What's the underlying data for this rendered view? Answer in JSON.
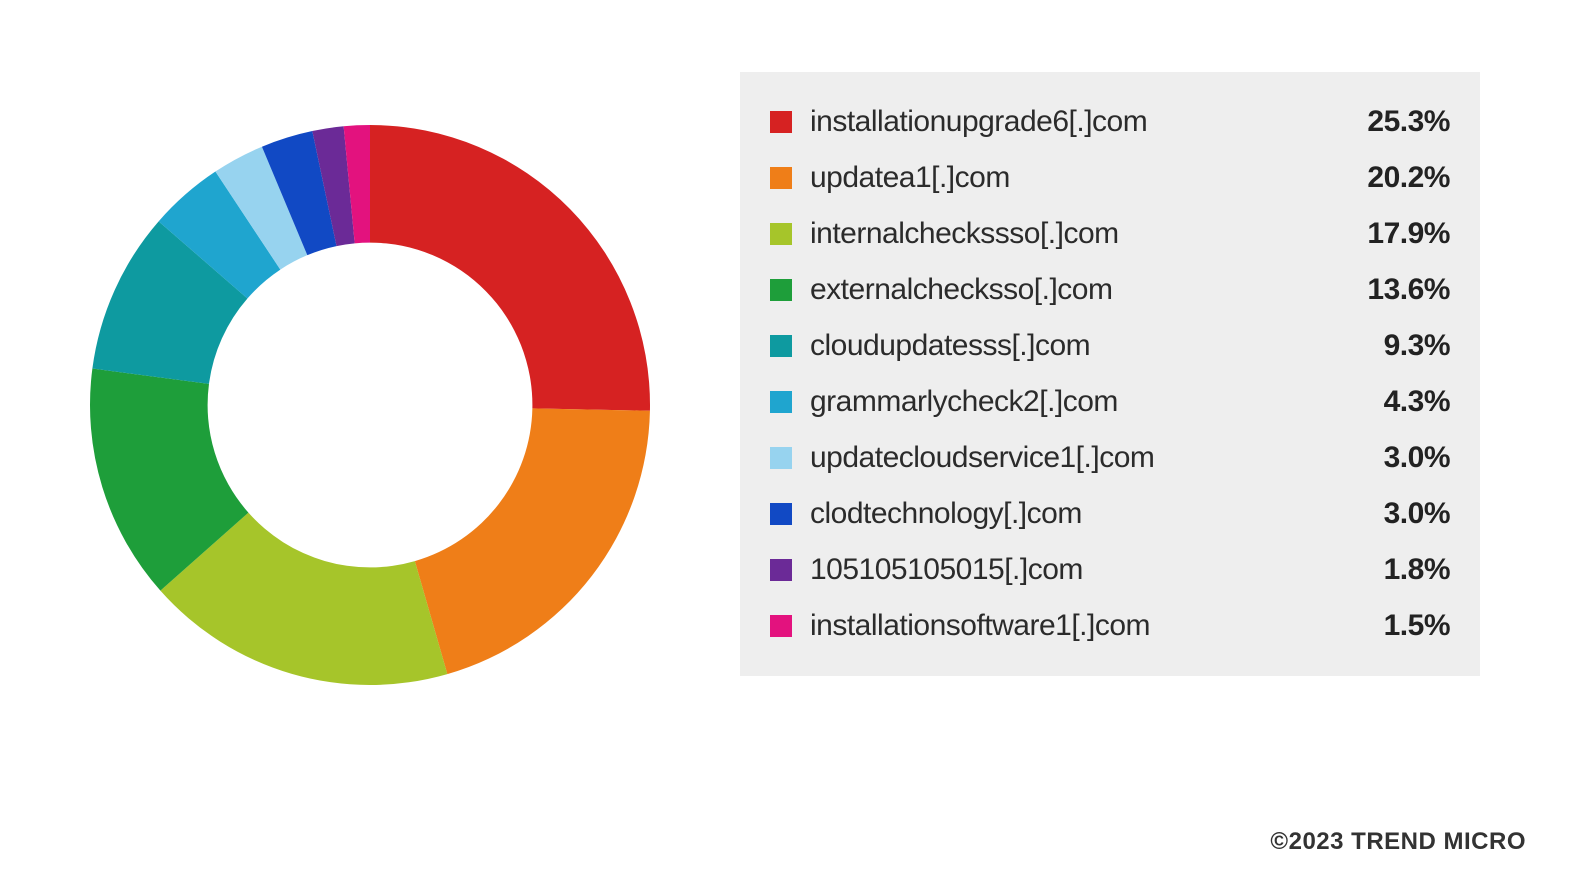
{
  "chart_data": {
    "type": "pie",
    "title": "",
    "series": [
      {
        "label": "installationupgrade6[.]com",
        "value": 25.3,
        "value_display": "25.3%",
        "color": "#d62222"
      },
      {
        "label": "updatea1[.]com",
        "value": 20.2,
        "value_display": "20.2%",
        "color": "#ef7e18"
      },
      {
        "label": "internalcheckssso[.]com",
        "value": 17.9,
        "value_display": "17.9%",
        "color": "#a6c52a"
      },
      {
        "label": "externalchecksso[.]com",
        "value": 13.6,
        "value_display": "13.6%",
        "color": "#1e9e3a"
      },
      {
        "label": "cloudupdatesss[.]com",
        "value": 9.3,
        "value_display": "9.3%",
        "color": "#0e9aa0"
      },
      {
        "label": "grammarlycheck2[.]com",
        "value": 4.3,
        "value_display": "4.3%",
        "color": "#1fa5cf"
      },
      {
        "label": "updatecloudservice1[.]com",
        "value": 3.0,
        "value_display": "3.0%",
        "color": "#97d3ef"
      },
      {
        "label": "clodtechnology[.]com",
        "value": 3.0,
        "value_display": "3.0%",
        "color": "#1149c4"
      },
      {
        "label": "105105105015[.]com",
        "value": 1.8,
        "value_display": "1.8%",
        "color": "#6b2a97"
      },
      {
        "label": "installationsoftware1[.]com",
        "value": 1.5,
        "value_display": "1.5%",
        "color": "#e3127e"
      }
    ],
    "donut_inner_ratio": 0.58,
    "start_angle_deg": -90,
    "legend_position": "right"
  },
  "credit": "©2023 TREND MICRO"
}
